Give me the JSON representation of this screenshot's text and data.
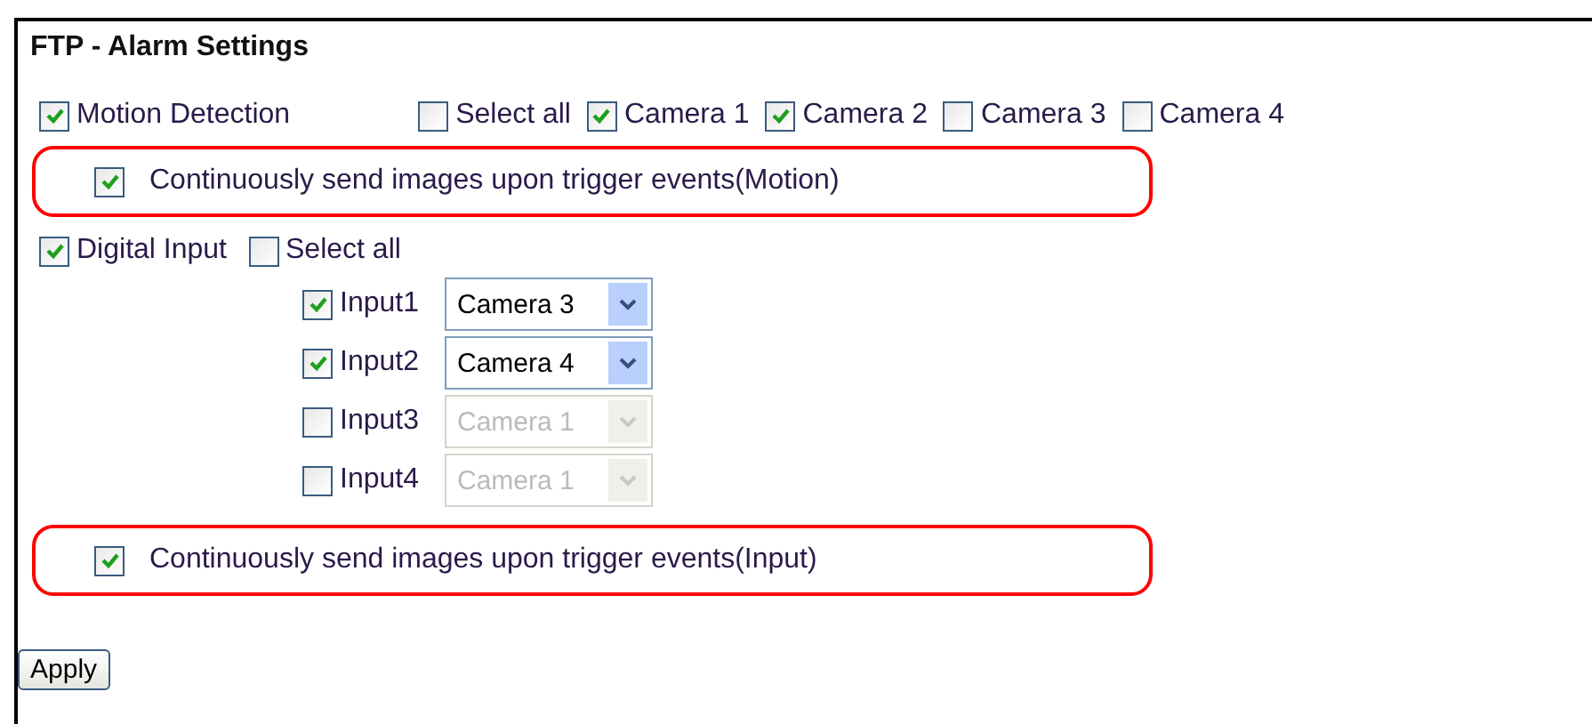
{
  "title": "FTP - Alarm Settings",
  "motion": {
    "label": "Motion Detection",
    "checked": true,
    "cameras": [
      {
        "label": "Select all",
        "checked": false
      },
      {
        "label": "Camera 1",
        "checked": true
      },
      {
        "label": "Camera 2",
        "checked": true
      },
      {
        "label": "Camera 3",
        "checked": false
      },
      {
        "label": "Camera 4",
        "checked": false
      }
    ],
    "continuous": {
      "label": "Continuously send images upon trigger events(Motion)",
      "checked": true
    }
  },
  "digital_input": {
    "label": "Digital Input",
    "checked": true,
    "select_all": {
      "label": "Select all",
      "checked": false
    },
    "inputs": [
      {
        "label": "Input1",
        "checked": true,
        "camera": "Camera 3",
        "disabled": false
      },
      {
        "label": "Input2",
        "checked": true,
        "camera": "Camera 4",
        "disabled": false
      },
      {
        "label": "Input3",
        "checked": false,
        "camera": "Camera 1",
        "disabled": true
      },
      {
        "label": "Input4",
        "checked": false,
        "camera": "Camera 1",
        "disabled": true
      }
    ],
    "continuous": {
      "label": "Continuously send images upon trigger events(Input)",
      "checked": true
    }
  },
  "apply_button": "Apply"
}
